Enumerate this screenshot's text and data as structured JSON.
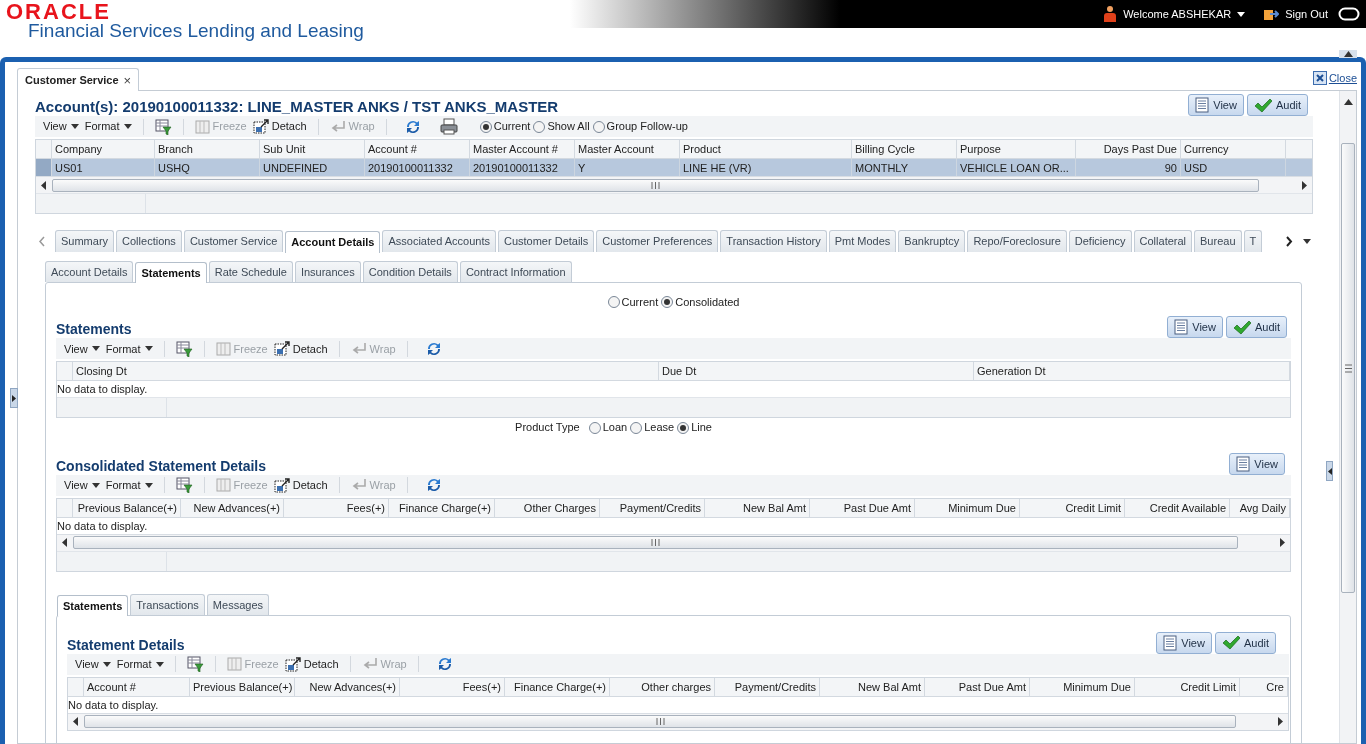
{
  "header": {
    "logo": "ORACLE",
    "product": "Financial Services Lending and Leasing",
    "user": "Welcome ABSHEKAR",
    "sign_out": "Sign Out"
  },
  "window_tab": {
    "label": "Customer Service",
    "close": "×"
  },
  "close_link": "Close",
  "account": {
    "title": "Account(s): 20190100011332: LINE_MASTER ANKS / TST ANKS_MASTER",
    "buttons": [
      {
        "kind": "view",
        "label": "View"
      },
      {
        "kind": "audit",
        "label": "Audit"
      }
    ],
    "toolbar": {
      "items": [
        {
          "kind": "menu",
          "label": "View"
        },
        {
          "kind": "menu",
          "label": "Format"
        },
        {
          "kind": "filter"
        },
        {
          "kind": "freeze",
          "label": "Freeze",
          "disabled": true
        },
        {
          "kind": "detach",
          "label": "Detach",
          "disabled": false
        },
        {
          "kind": "wrap",
          "label": "Wrap",
          "disabled": true
        },
        {
          "kind": "refresh"
        },
        {
          "kind": "print"
        }
      ],
      "options": [
        {
          "label": "Current",
          "selected": true
        },
        {
          "label": "Show All",
          "selected": false
        },
        {
          "label": "Group Follow-up",
          "selected": false
        }
      ]
    },
    "table": {
      "columns": [
        "Company",
        "Branch",
        "Sub Unit",
        "Account #",
        "Master Account #",
        "Master Account",
        "Product",
        "Billing Cycle",
        "Purpose",
        "Days Past Due",
        "Currency"
      ],
      "rows": [
        {
          "selected": true,
          "cells": [
            "US01",
            "USHQ",
            "UNDEFINED",
            "20190100011332",
            "20190100011332",
            "Y",
            "LINE HE (VR)",
            "MONTHLY",
            "VEHICLE LOAN OR...",
            "90",
            "USD"
          ]
        }
      ]
    }
  },
  "tabs": [
    {
      "label": "Summary",
      "selected": false
    },
    {
      "label": "Collections",
      "selected": false
    },
    {
      "label": "Customer Service",
      "selected": false
    },
    {
      "label": "Account Details",
      "selected": true
    },
    {
      "label": "Associated Accounts",
      "selected": false
    },
    {
      "label": "Customer Details",
      "selected": false
    },
    {
      "label": "Customer Preferences",
      "selected": false
    },
    {
      "label": "Transaction History",
      "selected": false
    },
    {
      "label": "Pmt Modes",
      "selected": false
    },
    {
      "label": "Bankruptcy",
      "selected": false
    },
    {
      "label": "Repo/Foreclosure",
      "selected": false
    },
    {
      "label": "Deficiency",
      "selected": false
    },
    {
      "label": "Collateral",
      "selected": false
    },
    {
      "label": "Bureau",
      "selected": false
    },
    {
      "label": "T",
      "selected": false
    }
  ],
  "sub_tabs": [
    {
      "label": "Account Details",
      "selected": false
    },
    {
      "label": "Statements",
      "selected": true
    },
    {
      "label": "Rate Schedule",
      "selected": false
    },
    {
      "label": "Insurances",
      "selected": false
    },
    {
      "label": "Condition Details",
      "selected": false
    },
    {
      "label": "Contract Information",
      "selected": false
    }
  ],
  "view_mode": [
    {
      "label": "Current",
      "selected": false
    },
    {
      "label": "Consolidated",
      "selected": true
    }
  ],
  "statements": {
    "title": "Statements",
    "buttons": [
      {
        "kind": "view",
        "label": "View"
      },
      {
        "kind": "audit",
        "label": "Audit"
      }
    ],
    "toolbar": {
      "items": [
        {
          "kind": "menu",
          "label": "View"
        },
        {
          "kind": "menu",
          "label": "Format"
        },
        {
          "kind": "filter"
        },
        {
          "kind": "freeze",
          "label": "Freeze",
          "disabled": true
        },
        {
          "kind": "detach",
          "label": "Detach",
          "disabled": false
        },
        {
          "kind": "wrap",
          "label": "Wrap",
          "disabled": true
        },
        {
          "kind": "refresh"
        }
      ]
    },
    "table": {
      "columns": [
        "Closing Dt",
        "Due Dt",
        "Generation Dt"
      ],
      "empty_text": "No data to display."
    }
  },
  "product_type": {
    "label": "Product Type",
    "options": [
      {
        "label": "Loan",
        "selected": false
      },
      {
        "label": "Lease",
        "selected": false
      },
      {
        "label": "Line",
        "selected": true
      }
    ]
  },
  "consolidated": {
    "title": "Consolidated Statement Details",
    "buttons": [
      {
        "kind": "view",
        "label": "View"
      }
    ],
    "toolbar": {
      "items": [
        {
          "kind": "menu",
          "label": "View"
        },
        {
          "kind": "menu",
          "label": "Format"
        },
        {
          "kind": "filter"
        },
        {
          "kind": "freeze",
          "label": "Freeze",
          "disabled": true
        },
        {
          "kind": "detach",
          "label": "Detach",
          "disabled": false
        },
        {
          "kind": "wrap",
          "label": "Wrap",
          "disabled": true
        },
        {
          "kind": "refresh"
        }
      ]
    },
    "table": {
      "columns": [
        "Previous Balance(+)",
        "New Advances(+)",
        "Fees(+)",
        "Finance Charge(+)",
        "Other Charges",
        "Payment/Credits",
        "New Bal Amt",
        "Past Due Amt",
        "Minimum Due",
        "Credit Limit",
        "Credit Available",
        "Avg Daily"
      ],
      "empty_text": "No data to display."
    }
  },
  "detail_tabs": [
    {
      "label": "Statements",
      "selected": true
    },
    {
      "label": "Transactions",
      "selected": false
    },
    {
      "label": "Messages",
      "selected": false
    }
  ],
  "statement_details": {
    "title": "Statement Details",
    "buttons": [
      {
        "kind": "view",
        "label": "View"
      },
      {
        "kind": "audit",
        "label": "Audit"
      }
    ],
    "toolbar": {
      "items": [
        {
          "kind": "menu",
          "label": "View"
        },
        {
          "kind": "menu",
          "label": "Format"
        },
        {
          "kind": "filter"
        },
        {
          "kind": "freeze",
          "label": "Freeze",
          "disabled": true
        },
        {
          "kind": "detach",
          "label": "Detach",
          "disabled": false
        },
        {
          "kind": "wrap",
          "label": "Wrap",
          "disabled": true
        },
        {
          "kind": "refresh"
        }
      ]
    },
    "table": {
      "columns": [
        "Account #",
        "Previous Balance(+)",
        "New Advances(+)",
        "Fees(+)",
        "Finance Charge(+)",
        "Other charges",
        "Payment/Credits",
        "New Bal Amt",
        "Past Due Amt",
        "Minimum Due",
        "Credit Limit",
        "Cre"
      ],
      "empty_text": "No data to display."
    }
  }
}
